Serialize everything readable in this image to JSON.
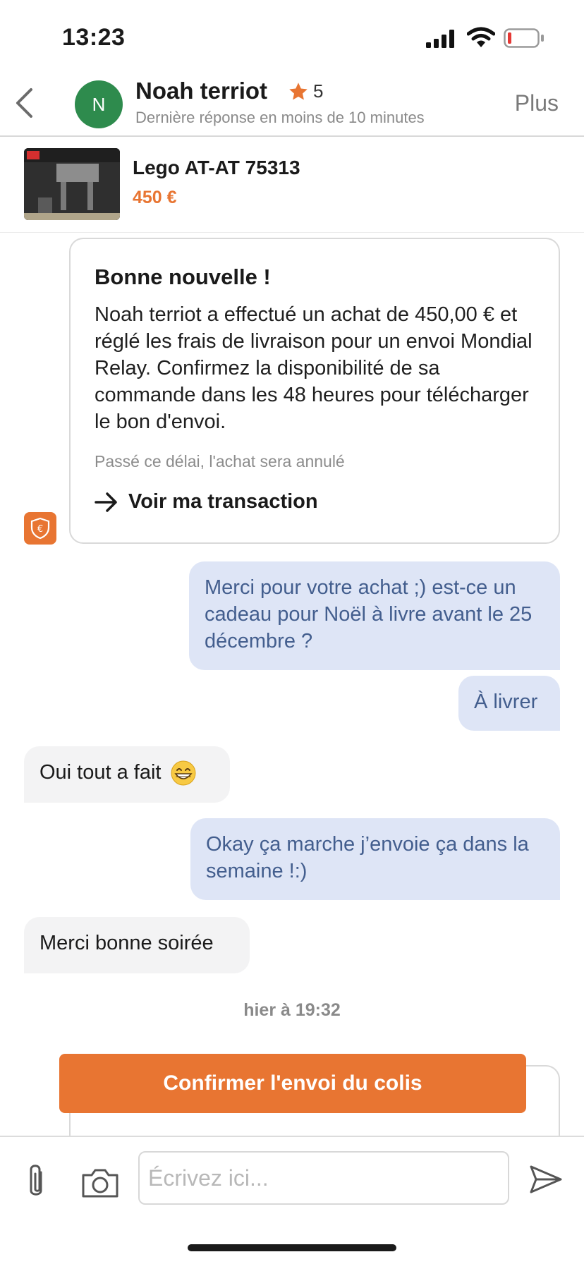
{
  "status_bar": {
    "time": "13:23",
    "icons": [
      "signal-icon",
      "wifi-icon",
      "battery-low-icon"
    ]
  },
  "header": {
    "back_icon": "chevron-left-icon",
    "avatar_initial": "N",
    "name": "Noah terriot",
    "rating": "5",
    "rating_icon": "star-icon",
    "response_time": "Dernière réponse en moins de 10 minutes",
    "more_label": "Plus"
  },
  "product": {
    "title": "Lego AT-AT 75313",
    "price": "450 €"
  },
  "transaction_card": {
    "title": "Bonne nouvelle !",
    "body": "Noah terriot a effectué un achat de 450,00 € et réglé les frais de livraison pour un envoi Mondial Relay. Confirmez la disponibilité de sa commande dans les 48 heures pour télécharger le bon d'envoi.",
    "note": "Passé ce délai, l'achat sera annulé",
    "link_label": "Voir ma transaction",
    "link_icon": "arrow-right-icon",
    "badge_icon": "euro-shield-icon"
  },
  "messages": [
    {
      "direction": "out",
      "text": "Merci pour votre achat ;) est-ce un cadeau pour Noël à livre avant le 25 décembre ?"
    },
    {
      "direction": "out",
      "text": "À livrer"
    },
    {
      "direction": "in",
      "text": "Oui tout a fait",
      "emoji": "grinning-face-icon"
    },
    {
      "direction": "out",
      "text": "Okay ça marche j’envoie ça dans la semaine !:)"
    },
    {
      "direction": "in",
      "text": "Merci bonne soirée"
    }
  ],
  "timestamp": "hier à 19:32",
  "confirm_button": "Confirmer l'envoi du colis",
  "composer": {
    "placeholder": "Écrivez ici...",
    "attach_icon": "paperclip-icon",
    "camera_icon": "camera-icon",
    "send_icon": "send-icon"
  },
  "colors": {
    "accent": "#e87532",
    "avatar": "#2e8b4d",
    "outgoing_bubble": "#dee5f6",
    "outgoing_text": "#435e8e",
    "incoming_bubble": "#f3f3f4"
  }
}
